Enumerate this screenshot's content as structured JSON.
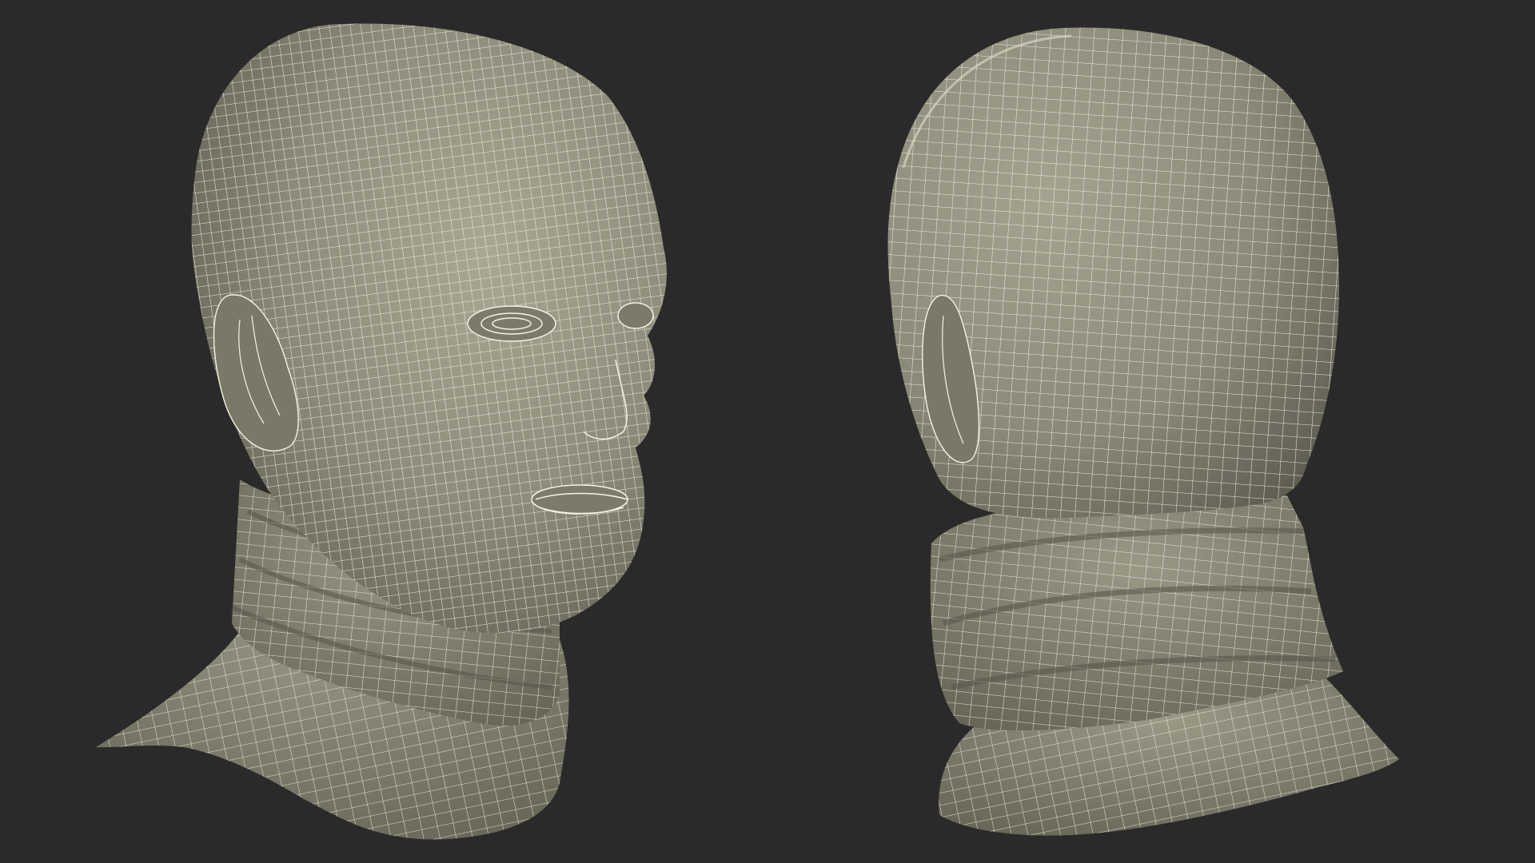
{
  "scene": {
    "background_color": "#2a2a2a",
    "surface_color": "#8d8c7a",
    "shadow_color": "#5e5d50",
    "highlight_color": "#bdbca8",
    "wire_color": "#f5f3e4"
  },
  "views": [
    {
      "name": "front-three-quarter-view",
      "subject": "head-with-neck-gaiter"
    },
    {
      "name": "back-three-quarter-view",
      "subject": "head-with-neck-gaiter"
    }
  ]
}
